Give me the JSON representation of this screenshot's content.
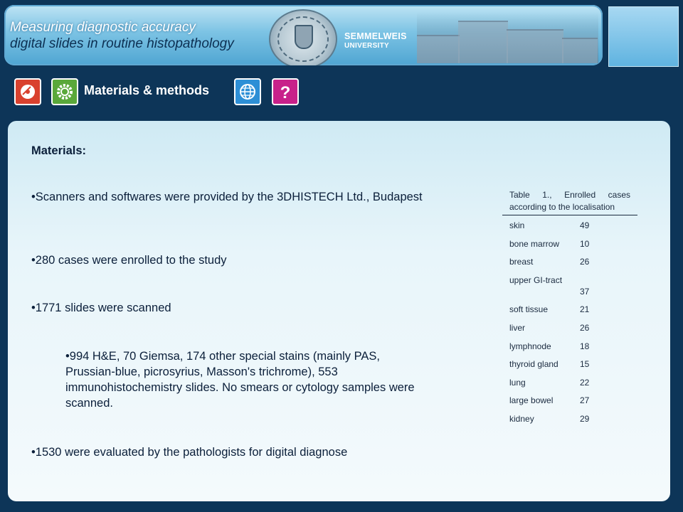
{
  "header": {
    "title_line1": "Measuring diagnostic accuracy",
    "title_line2": "digital slides in routine histopathology",
    "university_line1": "SEMMELWEIS",
    "university_line2": "UNIVERSITY"
  },
  "nav": {
    "title": "Materials & methods",
    "buttons": [
      {
        "icon": "disc-icon",
        "color": "#d9412e"
      },
      {
        "icon": "gear-icon",
        "color": "#5aa83a"
      },
      {
        "icon": "globe-icon",
        "color": "#2d8fd6"
      },
      {
        "icon": "help-icon",
        "color": "#c8218a"
      }
    ]
  },
  "materials": {
    "heading": "Materials:",
    "bullets": [
      "•Scanners and softwares were provided by the 3DHISTECH Ltd., Budapest",
      "•280 cases were enrolled to the study",
      "•1771 slides were scanned",
      "•994 H&E, 70 Giemsa, 174 other special stains (mainly PAS, Prussian-blue, picrosyrius, Masson's trichrome), 553 immunohistochemistry slides. No smears or cytology samples were scanned.",
      "•1530 were evaluated by the pathologists for digital diagnose"
    ]
  },
  "table": {
    "caption": "Table 1., Enrolled cases according to the localisation",
    "rows": [
      {
        "site": "skin",
        "count": "49"
      },
      {
        "site": "bone marrow",
        "count": "10"
      },
      {
        "site": "breast",
        "count": "26"
      },
      {
        "site": "upper GI-tract",
        "count": "37"
      },
      {
        "site": "soft tissue",
        "count": "21"
      },
      {
        "site": "liver",
        "count": "26"
      },
      {
        "site": "lymphnode",
        "count": "18"
      },
      {
        "site": "thyroid gland",
        "count": "15"
      },
      {
        "site": "lung",
        "count": "22"
      },
      {
        "site": "large bowel",
        "count": "27"
      },
      {
        "site": "kidney",
        "count": "29"
      }
    ]
  }
}
